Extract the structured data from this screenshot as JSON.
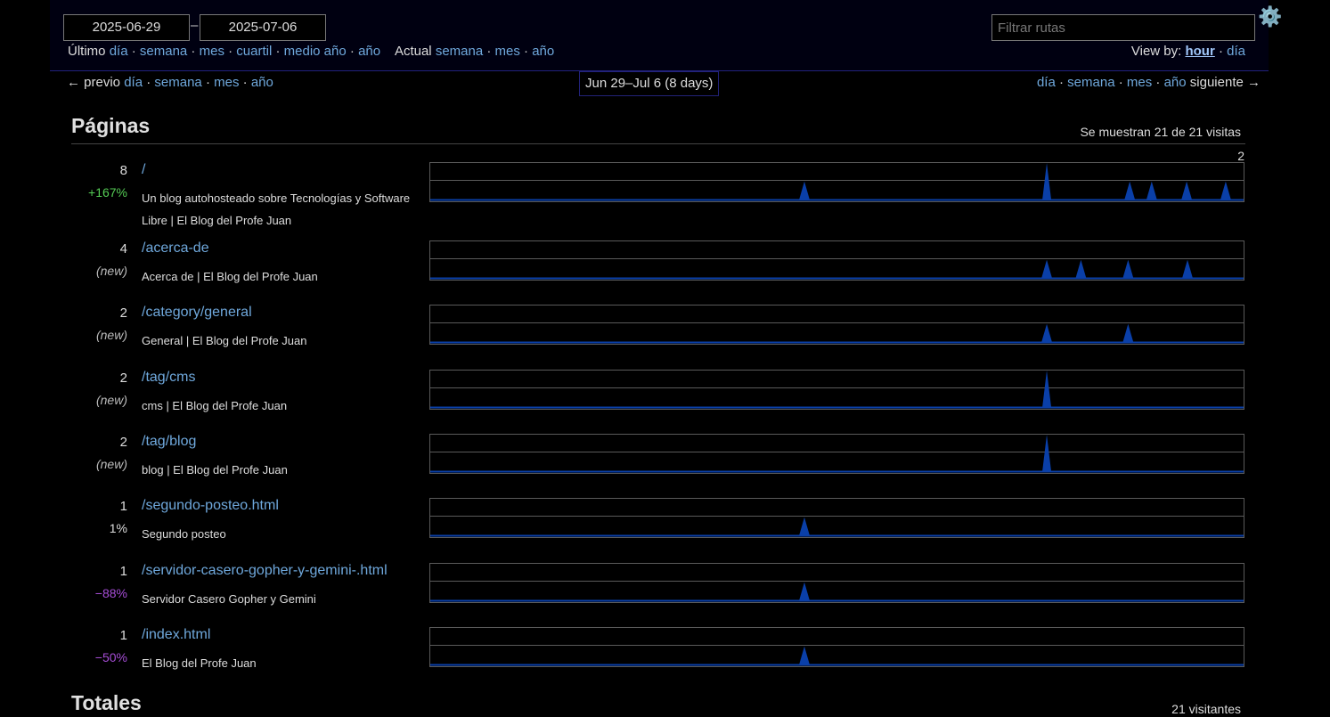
{
  "header": {
    "start_date": "2025-06-29",
    "end_date": "2025-07-06",
    "date_separator": "–",
    "last_label": "Último",
    "last_links": [
      "día",
      "semana",
      "mes",
      "cuartil",
      "medio año",
      "año"
    ],
    "current_label": "Actual",
    "current_links": [
      "semana",
      "mes",
      "año"
    ],
    "filter_placeholder": "Filtrar rutas",
    "settings_icon": "⚙️",
    "viewby_label": "View by:",
    "viewby_hour": "hour",
    "viewby_day": "día"
  },
  "nav": {
    "prev_label": "← previo",
    "prev_links": [
      "día",
      "semana",
      "mes",
      "año"
    ],
    "range": "Jun 29–Jul 6 (8 days)",
    "next_links": [
      "día",
      "semana",
      "mes",
      "año"
    ],
    "next_label": "siguiente →"
  },
  "pages": {
    "title": "Páginas",
    "note": "Se muestran 21 de 21 visitas",
    "chart_max": "2",
    "rows": [
      {
        "count": "8",
        "change": "+167%",
        "change_type": "up",
        "path": "/",
        "title": "Un blog autohosteado sobre Tecnologías y Software Libre | El Blog del Profe Juan",
        "peaks": [
          [
            0.46,
            1
          ],
          [
            0.758,
            2
          ],
          [
            0.86,
            1
          ],
          [
            0.887,
            1
          ],
          [
            0.93,
            1
          ],
          [
            0.978,
            1
          ]
        ]
      },
      {
        "count": "4",
        "change": "(new)",
        "change_type": "new",
        "path": "/acerca-de",
        "title": "Acerca de | El Blog del Profe Juan",
        "peaks": [
          [
            0.758,
            1
          ],
          [
            0.8,
            1
          ],
          [
            0.858,
            1
          ],
          [
            0.931,
            1
          ]
        ]
      },
      {
        "count": "2",
        "change": "(new)",
        "change_type": "new",
        "path": "/category/general",
        "title": "General | El Blog del Profe Juan",
        "peaks": [
          [
            0.758,
            1
          ],
          [
            0.858,
            1
          ]
        ]
      },
      {
        "count": "2",
        "change": "(new)",
        "change_type": "new",
        "path": "/tag/cms",
        "title": "cms | El Blog del Profe Juan",
        "peaks": [
          [
            0.758,
            2
          ]
        ]
      },
      {
        "count": "2",
        "change": "(new)",
        "change_type": "new",
        "path": "/tag/blog",
        "title": "blog | El Blog del Profe Juan",
        "peaks": [
          [
            0.758,
            2
          ]
        ]
      },
      {
        "count": "1",
        "change": "1%",
        "change_type": "neutral",
        "path": "/segundo-posteo.html",
        "title": "Segundo posteo",
        "peaks": [
          [
            0.46,
            1
          ]
        ]
      },
      {
        "count": "1",
        "change": "−88%",
        "change_type": "down",
        "path": "/servidor-casero-gopher-y-gemini-.html",
        "title": "Servidor Casero Gopher y Gemini",
        "peaks": [
          [
            0.46,
            1
          ]
        ]
      },
      {
        "count": "1",
        "change": "−50%",
        "change_type": "down",
        "path": "/index.html",
        "title": "El Blog del Profe Juan",
        "peaks": [
          [
            0.46,
            1
          ]
        ]
      }
    ]
  },
  "totals": {
    "title": "Totales",
    "note": "21 visitantes"
  },
  "colors": {
    "spark_fill": "#0a3fa8",
    "link": "#6fa8dc"
  }
}
